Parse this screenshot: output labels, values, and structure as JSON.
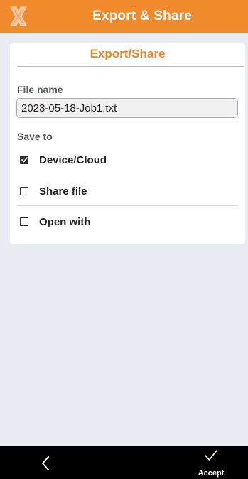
{
  "header": {
    "title": "Export & Share",
    "logo_icon": "app-logo-icon",
    "background_color": "#f08a2c"
  },
  "card": {
    "title": "Export/Share",
    "title_color": "#e8852b",
    "file_name_label": "File name",
    "file_name_value": "2023-05-18-Job1.txt",
    "save_to_label": "Save to",
    "options": [
      {
        "label": "Device/Cloud",
        "checked": true
      },
      {
        "label": "Share file",
        "checked": false
      },
      {
        "label": "Open with",
        "checked": false
      }
    ]
  },
  "footer": {
    "back_icon": "chevron-left-icon",
    "accept_icon": "checkmark-icon",
    "accept_label": "Accept"
  }
}
